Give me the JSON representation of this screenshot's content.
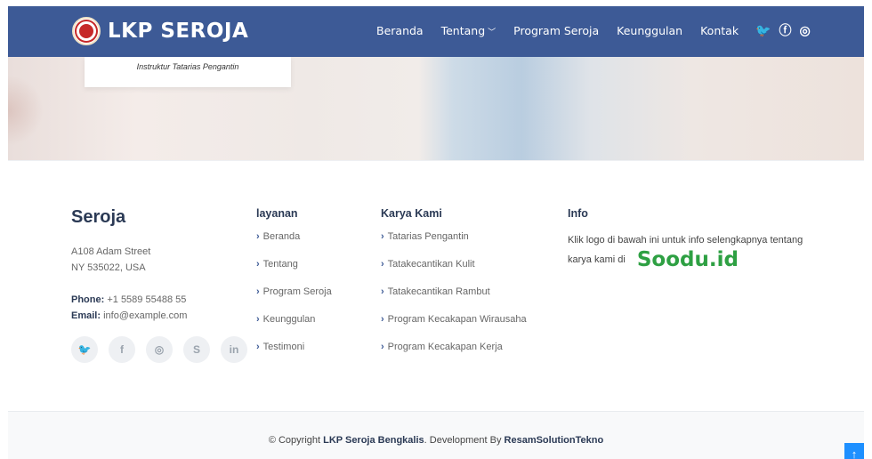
{
  "header": {
    "brand": "LKP SEROJA",
    "nav": [
      {
        "label": "Beranda"
      },
      {
        "label": "Tentang",
        "has_dropdown": true
      },
      {
        "label": "Program Seroja"
      },
      {
        "label": "Keunggulan"
      },
      {
        "label": "Kontak"
      }
    ],
    "socials": [
      {
        "icon": "twitter-icon",
        "glyph": "🐦"
      },
      {
        "icon": "facebook-icon",
        "glyph": "f"
      },
      {
        "icon": "instagram-icon",
        "glyph": "◎"
      }
    ]
  },
  "hero": {
    "card_text": "Instruktur Tatarias Pengantin"
  },
  "footer": {
    "seroja": {
      "title": "Seroja",
      "address_line1": "A108 Adam Street",
      "address_line2": "NY 535022, USA",
      "phone_label": "Phone:",
      "phone": "+1 5589 55488 55",
      "email_label": "Email:",
      "email": "info@example.com",
      "socials": [
        {
          "icon": "twitter-icon",
          "glyph": "🐦"
        },
        {
          "icon": "facebook-icon",
          "glyph": "f"
        },
        {
          "icon": "instagram-icon",
          "glyph": "◎"
        },
        {
          "icon": "skype-icon",
          "glyph": "S"
        },
        {
          "icon": "linkedin-icon",
          "glyph": "in"
        }
      ]
    },
    "layanan": {
      "title": "layanan",
      "items": [
        "Beranda",
        "Tentang",
        "Program Seroja",
        "Keunggulan",
        "Testimoni"
      ]
    },
    "karya": {
      "title": "Karya Kami",
      "items": [
        "Tatarias Pengantin",
        "Tatakecantikan Kulit",
        "Tatakecantikan Rambut",
        "Program Kecakapan Wirausaha",
        "Program Kecakapan Kerja"
      ]
    },
    "info": {
      "title": "Info",
      "text": "Klik logo di bawah ini untuk info selengkapnya tentang karya kami di",
      "link_logo": "Soodu.id"
    },
    "bottom": {
      "prefix": "© Copyright ",
      "company": "LKP Seroja Bengkalis",
      "middle": ". Development By ",
      "developer": "ResamSolutionTekno"
    },
    "back_to_top": "↑"
  },
  "colors": {
    "header_bg": "#3d5a96",
    "soodu_green": "#2ea043",
    "back_to_top": "#1e90ff"
  }
}
